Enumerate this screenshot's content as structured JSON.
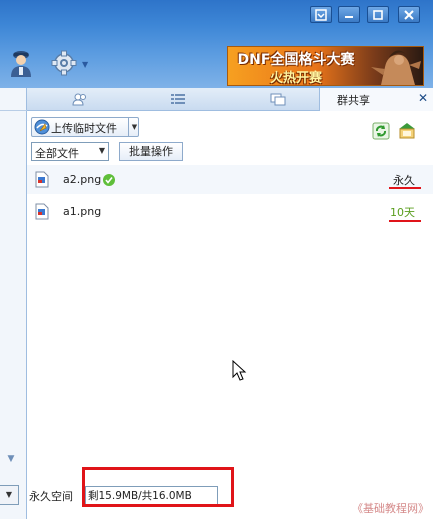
{
  "window": {
    "buttons": [
      {
        "name": "menu-button",
        "glyph": "▣"
      },
      {
        "name": "minimize-button",
        "glyph": "—"
      },
      {
        "name": "maximize-button",
        "glyph": "□"
      },
      {
        "name": "close-button",
        "glyph": "✕"
      }
    ]
  },
  "header": {
    "user_icon": "user-avatar-icon",
    "settings_icon": "gear-icon",
    "ad": {
      "line1": "DNF全国格斗大赛",
      "line2": "火热开赛"
    }
  },
  "tabs": {
    "icons": [
      "members-icon",
      "list-icon",
      "window-icon"
    ],
    "active": {
      "label": "群共享",
      "close": "✕"
    }
  },
  "toolbar": {
    "upload_label": "上传临时文件",
    "filter_value": "全部文件",
    "batch_label": "批量操作"
  },
  "files": [
    {
      "name": "a2.png",
      "expire": "永久",
      "expire_color": "#222222",
      "verified": true
    },
    {
      "name": "a1.png",
      "expire": "10天",
      "expire_color": "#5a9e1e",
      "verified": false
    }
  ],
  "footer": {
    "space_label": "永久空间",
    "space_value": "剩15.9MB/共16.0MB",
    "watermark": "《基础教程网》"
  },
  "colors": {
    "highlight_red": "#e01418",
    "title_blue": "#3d86d6"
  }
}
